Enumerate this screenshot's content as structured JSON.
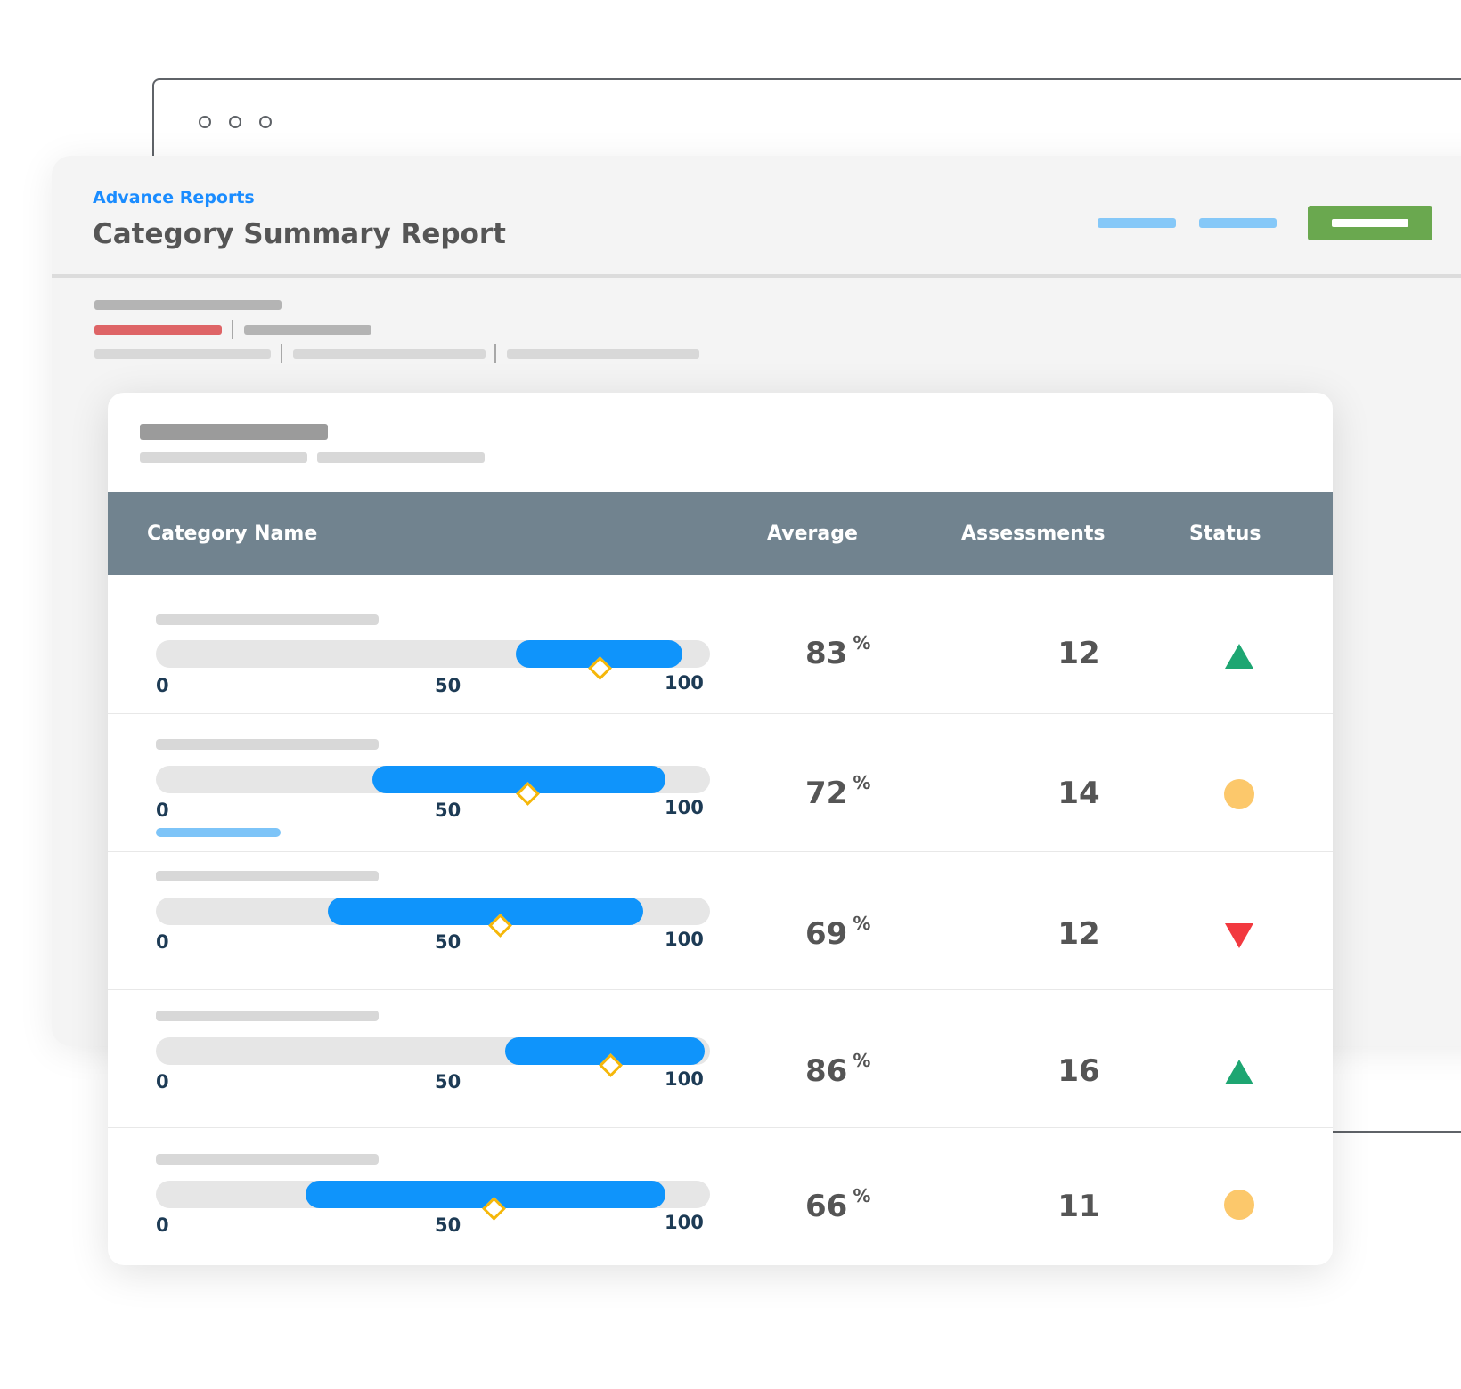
{
  "header": {
    "breadcrumb": "Advance Reports",
    "title": "Category Summary Report"
  },
  "colors": {
    "accent_blue": "#1a8cff",
    "bar_blue": "#0f94fb",
    "primary_green": "#6aa84f",
    "table_header": "#71838f",
    "status_up": "#1ea672",
    "status_down": "#f2393f",
    "status_neutral": "#fcc86b",
    "marker": "#f5b70a",
    "filter_highlight": "#de6466"
  },
  "table": {
    "columns": [
      "Category Name",
      "Average",
      "Assessments",
      "Status"
    ],
    "scale_ticks": [
      "0",
      "50",
      "100"
    ],
    "percent_sign": "%",
    "rows": [
      {
        "range_low": 65,
        "range_high": 95,
        "marker": 80,
        "average": "83",
        "assessments": "12",
        "status": "up"
      },
      {
        "range_low": 39,
        "range_high": 92,
        "marker": 67,
        "average": "72",
        "assessments": "14",
        "status": "neutral"
      },
      {
        "range_low": 31,
        "range_high": 88,
        "marker": 62,
        "average": "69",
        "assessments": "12",
        "status": "down"
      },
      {
        "range_low": 63,
        "range_high": 99,
        "marker": 82,
        "average": "86",
        "assessments": "16",
        "status": "up"
      },
      {
        "range_low": 27,
        "range_high": 92,
        "marker": 61,
        "average": "66",
        "assessments": "11",
        "status": "neutral"
      }
    ]
  }
}
